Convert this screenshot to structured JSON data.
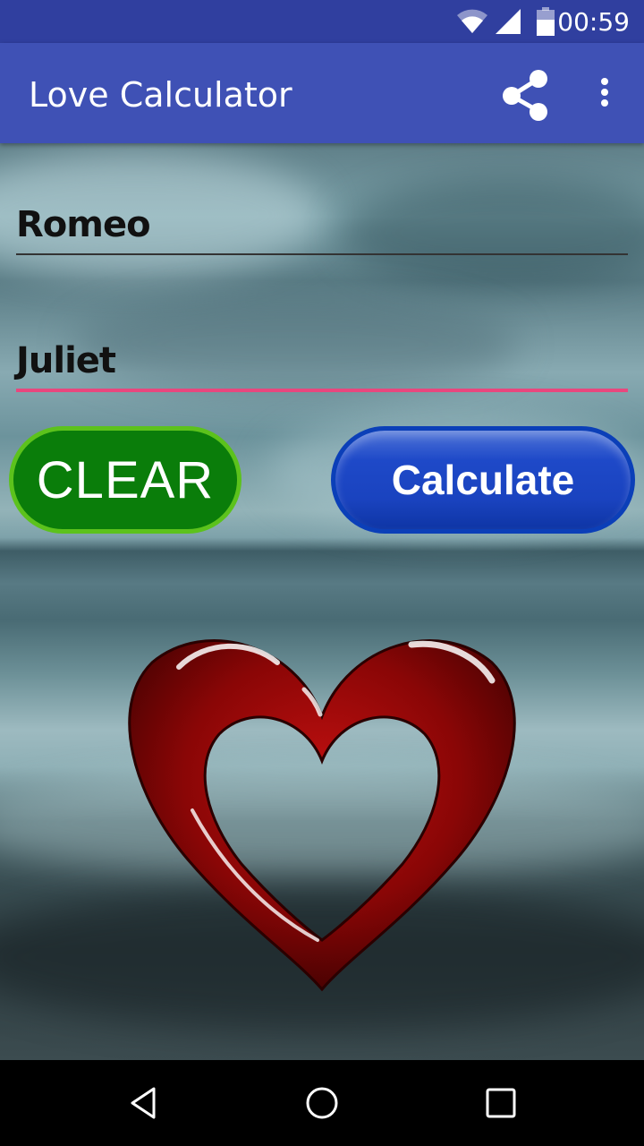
{
  "status_bar": {
    "time": "00:59",
    "icons": [
      "wifi-icon",
      "cellular-signal-icon",
      "battery-icon"
    ]
  },
  "app_bar": {
    "title": "Love Calculator",
    "actions": [
      {
        "name": "share",
        "icon": "share-icon"
      },
      {
        "name": "overflow-menu",
        "icon": "more-vert-icon"
      }
    ],
    "color": "#3F51B5",
    "status_color": "#303F9F"
  },
  "form": {
    "name1": {
      "value": "Romeo",
      "underline_color": "#333333"
    },
    "name2": {
      "value": "Juliet",
      "underline_color": "#E8477E",
      "focused": true
    }
  },
  "buttons": {
    "clear_label": "CLEAR",
    "calculate_label": "Calculate"
  },
  "image": {
    "background": "stormy-sea-background",
    "heart": "red-rose-heart-image"
  },
  "nav_bar": {
    "buttons": [
      "back-icon",
      "home-icon",
      "recents-icon"
    ]
  }
}
